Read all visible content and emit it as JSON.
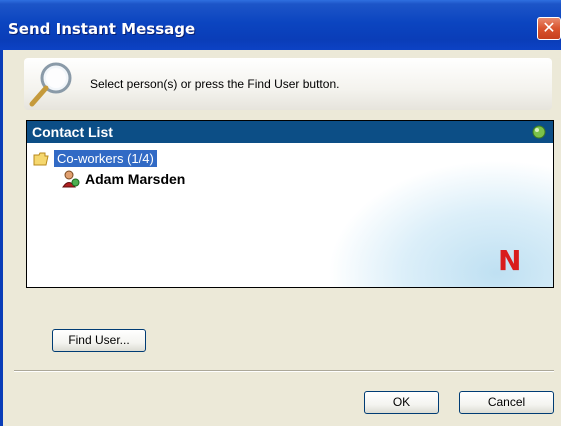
{
  "window": {
    "title": "Send Instant Message",
    "close_glyph": "✕"
  },
  "banner": {
    "icon": "magnifier-icon",
    "message": "Select person(s) or press the Find User button."
  },
  "contact_list": {
    "header": "Contact List",
    "status_icon": "green-status-icon",
    "group": {
      "label": "Co-workers (1/4)",
      "icon": "folder-icon",
      "selected": true
    },
    "contacts": [
      {
        "name": "Adam Marsden",
        "icon": "online-user-icon"
      }
    ],
    "brand_logo": "N"
  },
  "buttons": {
    "find_user": "Find User...",
    "ok": "OK",
    "cancel": "Cancel"
  },
  "colors": {
    "titlebar": "#0a3db8",
    "list_header": "#0c4e86",
    "selection": "#316ac5",
    "logo": "#d91c1c"
  }
}
